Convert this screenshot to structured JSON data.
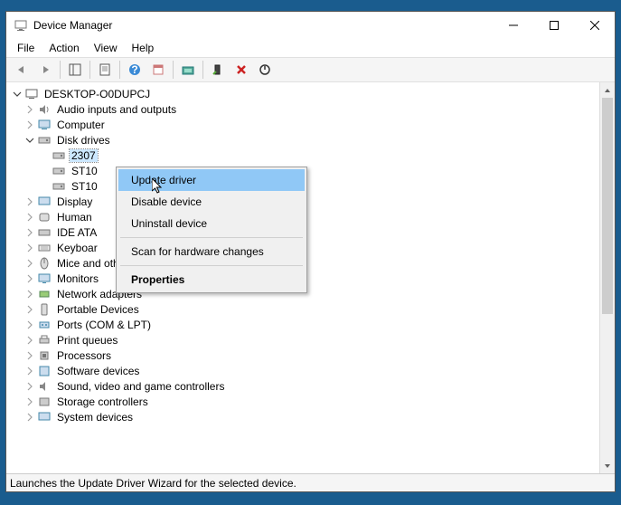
{
  "window": {
    "title": "Device Manager"
  },
  "menubar": [
    "File",
    "Action",
    "View",
    "Help"
  ],
  "root": {
    "label": "DESKTOP-O0DUPCJ"
  },
  "categories": [
    {
      "label": "Audio inputs and outputs",
      "expanded": false
    },
    {
      "label": "Computer",
      "expanded": false
    },
    {
      "label": "Disk drives",
      "expanded": true,
      "children": [
        {
          "label": "2307"
        },
        {
          "label": "ST10"
        },
        {
          "label": "ST10"
        }
      ]
    },
    {
      "label": "Display",
      "expanded": false,
      "truncated": true
    },
    {
      "label": "Human",
      "expanded": false,
      "truncated": true
    },
    {
      "label": "IDE ATA",
      "expanded": false,
      "truncated": true
    },
    {
      "label": "Keyboar",
      "expanded": false,
      "truncated": true
    },
    {
      "label": "Mice and other pointing devices",
      "expanded": false
    },
    {
      "label": "Monitors",
      "expanded": false
    },
    {
      "label": "Network adapters",
      "expanded": false
    },
    {
      "label": "Portable Devices",
      "expanded": false
    },
    {
      "label": "Ports (COM & LPT)",
      "expanded": false
    },
    {
      "label": "Print queues",
      "expanded": false
    },
    {
      "label": "Processors",
      "expanded": false
    },
    {
      "label": "Software devices",
      "expanded": false
    },
    {
      "label": "Sound, video and game controllers",
      "expanded": false
    },
    {
      "label": "Storage controllers",
      "expanded": false
    },
    {
      "label": "System devices",
      "expanded": false
    }
  ],
  "context_menu": {
    "items": [
      {
        "label": "Update driver",
        "highlighted": true
      },
      {
        "label": "Disable device"
      },
      {
        "label": "Uninstall device"
      },
      {
        "sep": true
      },
      {
        "label": "Scan for hardware changes"
      },
      {
        "sep": true
      },
      {
        "label": "Properties",
        "bold": true
      }
    ]
  },
  "statusbar": {
    "text": "Launches the Update Driver Wizard for the selected device."
  }
}
